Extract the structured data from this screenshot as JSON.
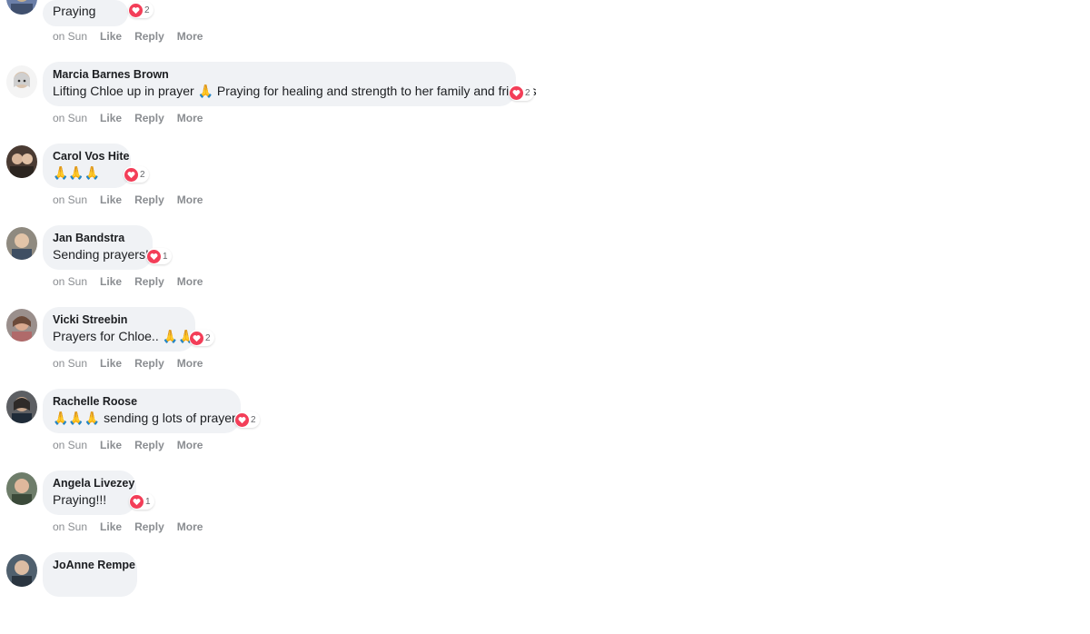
{
  "colors": {
    "bubble": "#f0f2f5",
    "heart": "#f33e58",
    "meta": "#8a8d91"
  },
  "actions": {
    "like": "Like",
    "reply": "Reply",
    "more": "More"
  },
  "comments": [
    {
      "author": "",
      "text": "Praying",
      "reactions": "2",
      "time": "on Sun"
    },
    {
      "author": "Marcia Barnes Brown",
      "text_a": "Lifting Chloe up in prayer ",
      "text_b": " Praying for healing and strength to her family and friends",
      "emoji": "🙏",
      "reactions": "2",
      "time": "on Sun"
    },
    {
      "author": "Carol Vos Hite",
      "text": "🙏🙏🙏",
      "reactions": "2",
      "time": "on Sun"
    },
    {
      "author": "Jan Bandstra",
      "text": "Sending prayers!",
      "reactions": "1",
      "time": "on Sun"
    },
    {
      "author": "Vicki Streebin",
      "text_a": "Prayers for Chloe.. ",
      "emoji": "🙏🙏",
      "reactions": "2",
      "time": "on Sun"
    },
    {
      "author": "Rachelle Roose",
      "emoji": "🙏🙏🙏",
      "text_b": " sending g lots of prayers",
      "reactions": "2",
      "time": "on Sun"
    },
    {
      "author": "Angela Livezey",
      "text": "Praying!!!",
      "reactions": "1",
      "time": "on Sun"
    },
    {
      "author": "JoAnne Rempe"
    }
  ],
  "icons": {
    "reaction": "heart-icon",
    "avatar": "avatar-photo"
  }
}
